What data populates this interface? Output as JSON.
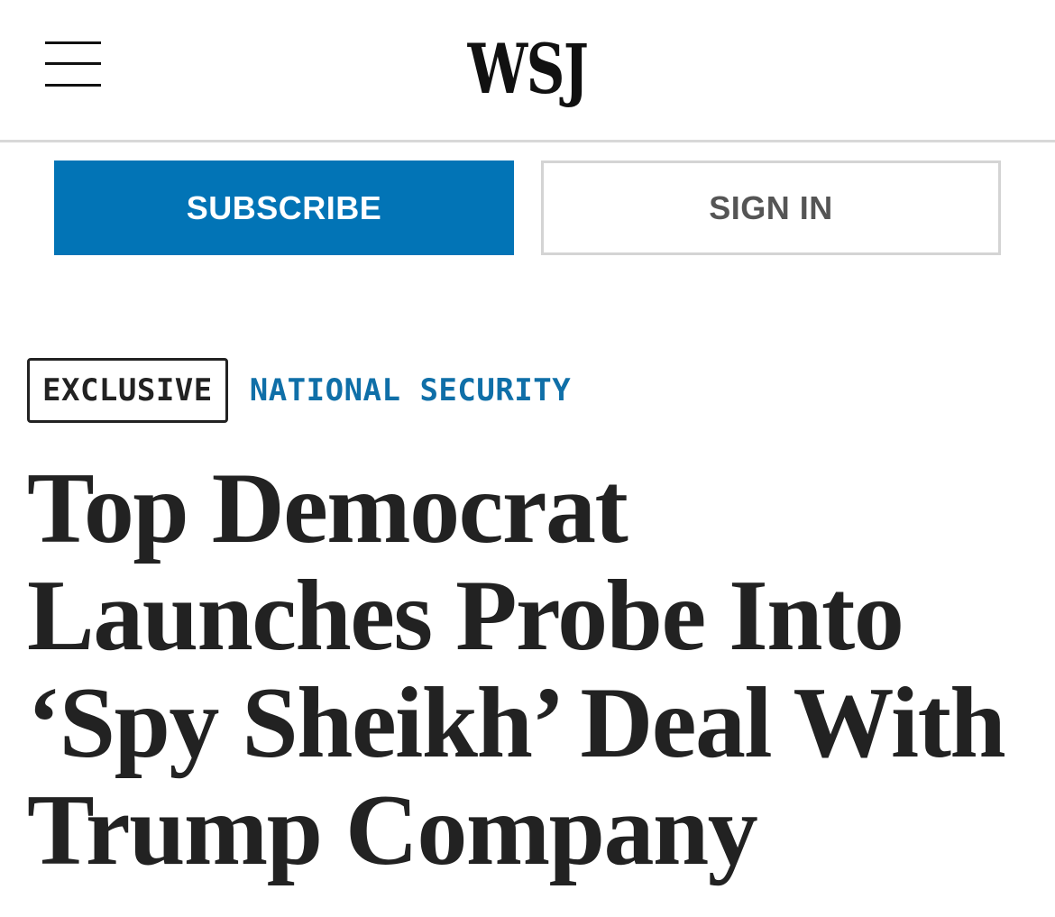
{
  "header": {
    "logo": "WSJ",
    "menu_icon": "hamburger-menu-icon"
  },
  "actions": {
    "subscribe_label": "SUBSCRIBE",
    "signin_label": "SIGN IN"
  },
  "article": {
    "badge": "EXCLUSIVE",
    "section": "NATIONAL SECURITY",
    "headline": "Top Democrat Launches Probe Into ‘Spy Sheikh’ Deal With Trump Company"
  },
  "colors": {
    "subscribe_bg": "#0274b6",
    "section_link": "#0f6fa8",
    "divider": "#d8d8d8"
  }
}
